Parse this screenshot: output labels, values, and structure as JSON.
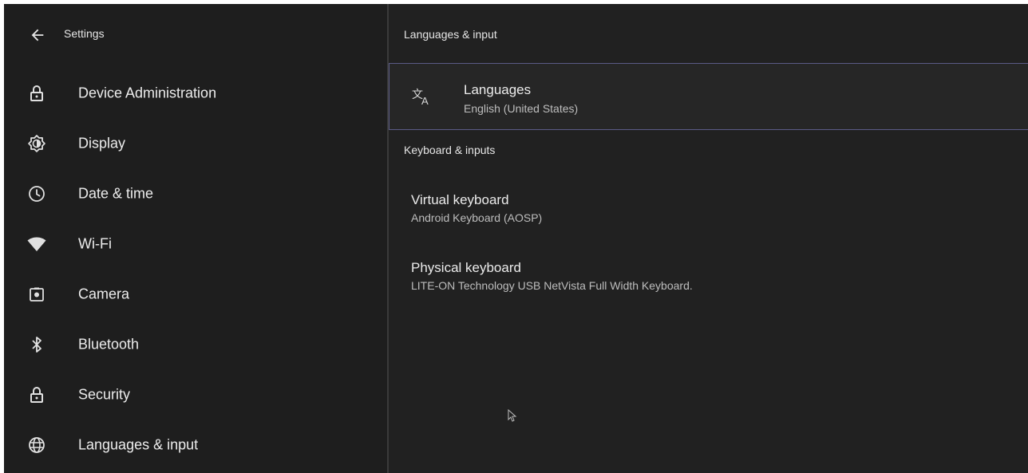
{
  "sidebar": {
    "title": "Settings",
    "back_icon": "arrow-back-icon",
    "items": [
      {
        "label": "Device Administration",
        "icon": "lock-icon"
      },
      {
        "label": "Display",
        "icon": "brightness-icon"
      },
      {
        "label": "Date & time",
        "icon": "clock-icon"
      },
      {
        "label": "Wi-Fi",
        "icon": "wifi-icon"
      },
      {
        "label": "Camera",
        "icon": "camera-icon"
      },
      {
        "label": "Bluetooth",
        "icon": "bluetooth-icon"
      },
      {
        "label": "Security",
        "icon": "lock-icon"
      },
      {
        "label": "Languages & input",
        "icon": "globe-icon"
      }
    ]
  },
  "main": {
    "title": "Languages & input",
    "languages": {
      "title": "Languages",
      "summary": "English (United States)",
      "icon": "translate-icon"
    },
    "keyboard_section": {
      "header": "Keyboard & inputs",
      "items": [
        {
          "title": "Virtual keyboard",
          "summary": "Android Keyboard (AOSP)"
        },
        {
          "title": "Physical keyboard",
          "summary": "LITE-ON Technology USB NetVista Full Width Keyboard."
        }
      ]
    }
  },
  "colors": {
    "background": "#1f1f1f",
    "focus_border": "#5b5b86",
    "text_primary": "#ececec",
    "text_secondary": "#bdbdbd"
  }
}
